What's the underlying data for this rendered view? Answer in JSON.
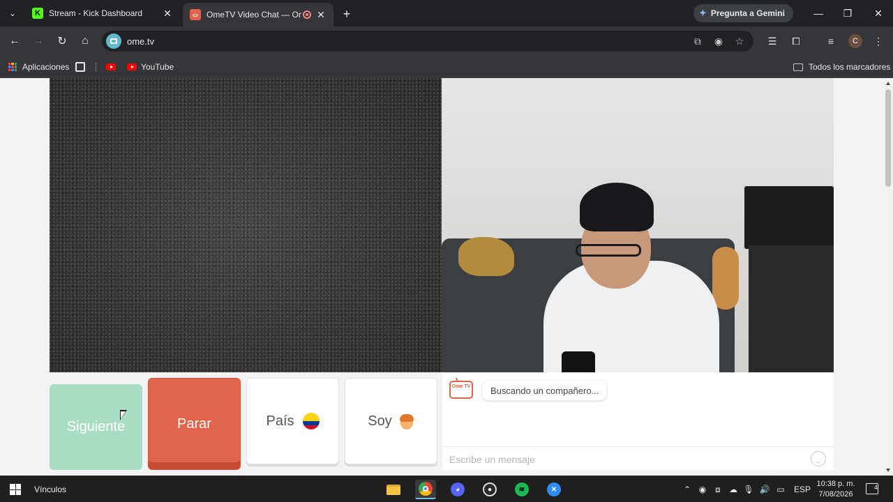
{
  "browser": {
    "tabs": [
      {
        "title": "Stream - Kick Dashboard",
        "favicon": "kick-icon",
        "active": false
      },
      {
        "title": "OmeTV Video Chat — Ome",
        "favicon": "ometv-icon",
        "active": true,
        "recording": true
      }
    ],
    "gemini_label": "Pregunta a Gemini",
    "url": "ome.tv",
    "profile_initial": "C",
    "bookmarks": {
      "apps_label": "Aplicaciones",
      "youtube_label": "YouTube",
      "all_bookmarks_label": "Todos los marcadores"
    }
  },
  "ometv": {
    "buttons": {
      "next": "Siguiente",
      "stop": "Parar",
      "country": "País",
      "gender": "Soy"
    },
    "logo_text": "Ome TV",
    "status_message": "Buscando un compañero...",
    "message_placeholder": "Escribe un mensaje",
    "colors": {
      "accent": "#e0644a",
      "next": "#a9dec4"
    }
  },
  "taskbar": {
    "links_label": "Vínculos",
    "language": "ESP",
    "time": "10:38 p. m.",
    "date": "7/08/2026",
    "notifications": "4",
    "apps": [
      "file-explorer-icon",
      "chrome-icon",
      "discord-icon",
      "obs-icon",
      "spotify-icon",
      "app-icon"
    ]
  }
}
